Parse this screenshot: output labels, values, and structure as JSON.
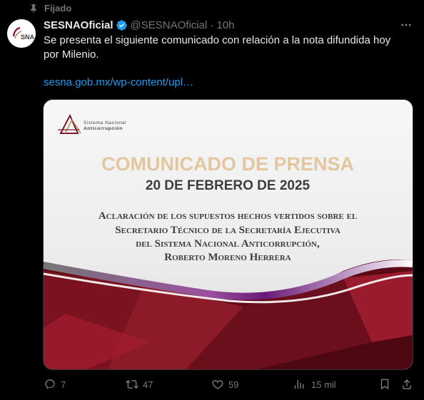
{
  "pinned_label": "Fijado",
  "author": {
    "name": "SESNAOficial",
    "handle": "@SESNAOficial",
    "time": "· 10h",
    "avatar_text": "SNA"
  },
  "tweet": {
    "text": "Se presenta el siguiente comunicado con relación a la nota difundida hoy por Milenio.",
    "link": "sesna.gob.mx/wp-content/upl…"
  },
  "card": {
    "org_line1": "Sistema Nacional",
    "org_line2": "Anticorrupción",
    "title": "COMUNICADO DE PRENSA",
    "date": "20 DE FEBRERO DE 2025",
    "body": [
      "Aclaración de los supuestos hechos vertidos sobre el",
      "Secretario Técnico de la Secretaría Ejecutiva",
      "del Sistema Nacional Anticorrupción,",
      "Roberto Moreno Herrera"
    ]
  },
  "actions": {
    "replies": "7",
    "reposts": "47",
    "likes": "59",
    "views": "15 mil"
  },
  "colors": {
    "accent": "#1d9bf0",
    "muted": "#71767b",
    "title_gold": "#e2c79f",
    "maroon": "#6b0f1a"
  }
}
